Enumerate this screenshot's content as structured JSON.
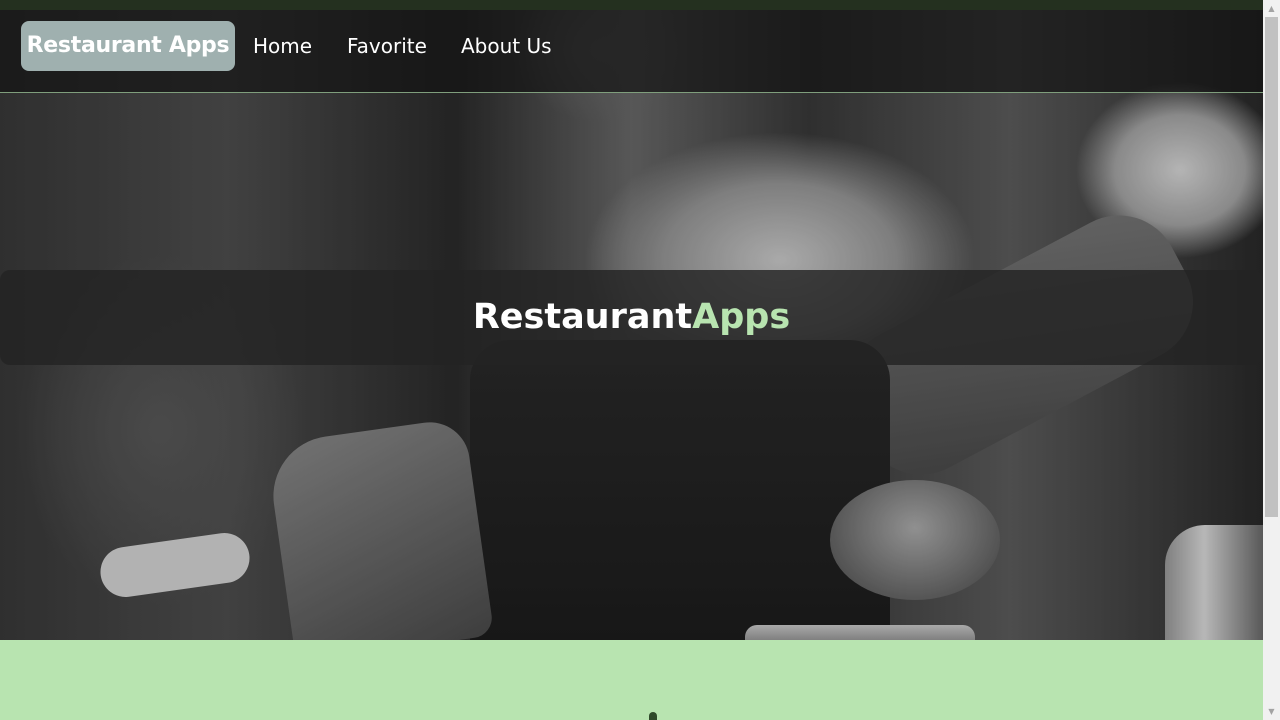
{
  "navbar": {
    "brand": "Restaurant Apps",
    "links": [
      {
        "label": "Home"
      },
      {
        "label": "Favorite"
      },
      {
        "label": "About Us"
      }
    ]
  },
  "hero": {
    "title_part1": "Restaurant",
    "title_part2": "Apps"
  },
  "colors": {
    "accent_green": "#b8e4b0",
    "brand_bg": "#9fb0af",
    "top_strip": "#24301f"
  },
  "icons": {
    "scroll_up": "triangle-up",
    "scroll_down": "triangle-down"
  }
}
